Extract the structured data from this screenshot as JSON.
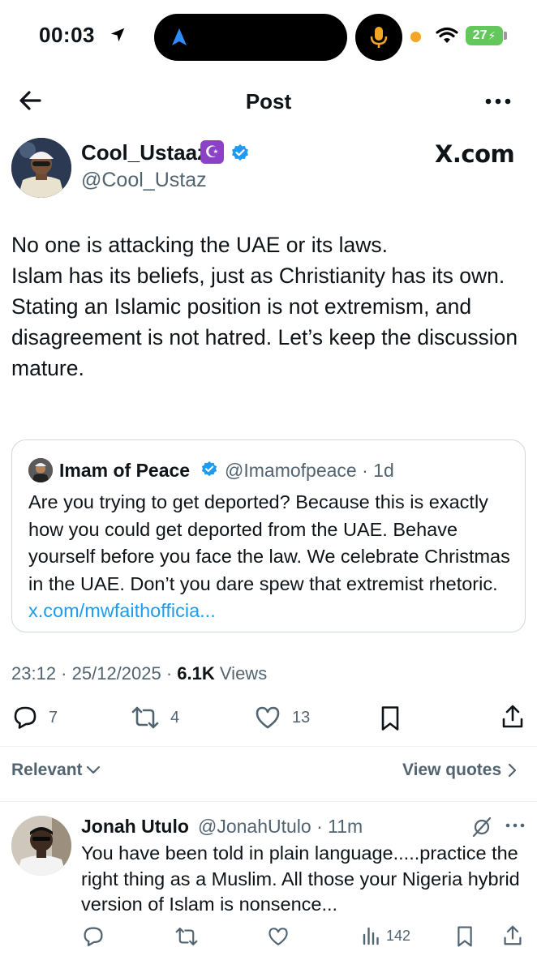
{
  "status_bar": {
    "time": "00:03",
    "battery": "27"
  },
  "header": {
    "title": "Post"
  },
  "post": {
    "author_name": "Cool_Ustaaz",
    "author_badge": "☪",
    "author_handle": "@Cool_Ustaz",
    "site_mark": "X.com",
    "text_lines": [
      "No one is attacking the UAE or its laws.",
      "Islam has its beliefs, just as Christianity has its own.",
      "Stating an Islamic position is not extremism, and disagreement is not hatred. Let’s keep the discussion mature."
    ],
    "time": "23:12",
    "date": "25/12/2025",
    "views_count": "6.1K",
    "views_label": "Views",
    "replies": "7",
    "reposts": "4",
    "likes": "13"
  },
  "quote": {
    "name": "Imam of Peace",
    "handle": "@Imamofpeace",
    "age": "1d",
    "text": "Are you trying to get deported? Because this is exactly how you could get deported from the UAE. Behave yourself before you face the law. We celebrate Christmas in the UAE. Don’t you dare spew that extremist rhetoric. ",
    "link": "x.com/mwfaithofficia..."
  },
  "replies_bar": {
    "sort_label": "Relevant",
    "view_quotes_label": "View quotes"
  },
  "reply": {
    "name": "Jonah Utulo",
    "handle": "@JonahUtulo",
    "age": "11m",
    "text": "You have been told in plain language.....practice the right thing as a Muslim. All those your Nigeria hybrid version of Islam is nonsence...",
    "views": "142"
  },
  "colors": {
    "accent": "#1d9bf0",
    "secondary_text": "#536471",
    "badge_purple": "#8b42c8",
    "battery_green": "#63c75c"
  }
}
